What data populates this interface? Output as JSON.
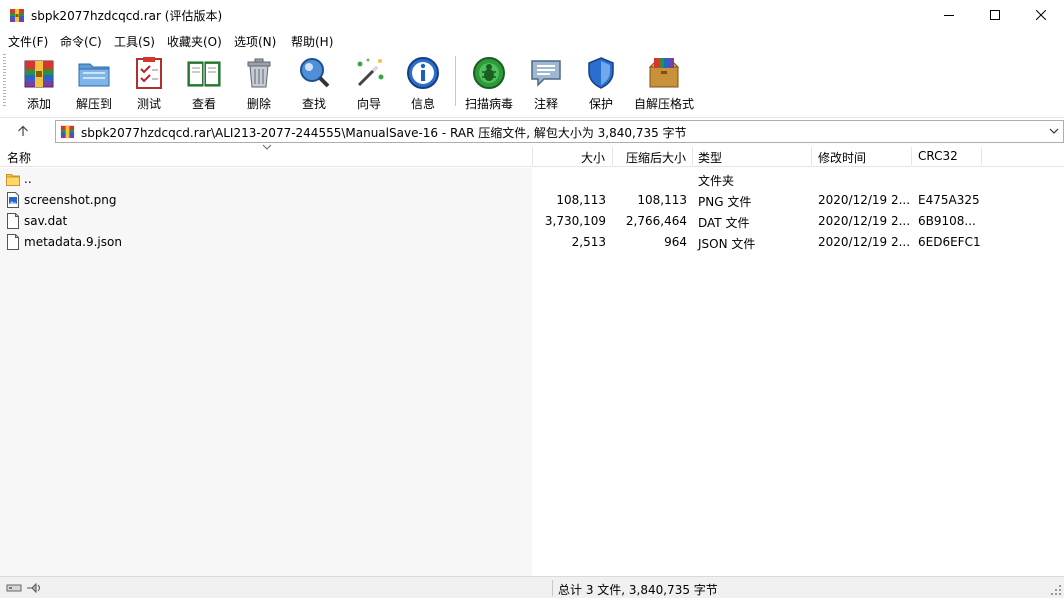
{
  "window": {
    "title": "sbpk2077hzdcqcd.rar (评估版本)",
    "controls": {
      "minimize": "minimize",
      "maximize": "maximize",
      "close": "close"
    }
  },
  "menu": [
    "文件(F)",
    "命令(C)",
    "工具(S)",
    "收藏夹(O)",
    "选项(N)",
    "帮助(H)"
  ],
  "toolbar": {
    "add": "添加",
    "extract_to": "解压到",
    "test": "测试",
    "view": "查看",
    "delete": "删除",
    "find": "查找",
    "wizard": "向导",
    "info": "信息",
    "virus_scan": "扫描病毒",
    "comment": "注释",
    "protect": "保护",
    "sfx": "自解压格式"
  },
  "address": {
    "path": "sbpk2077hzdcqcd.rar\\ALI213-2077-244555\\ManualSave-16 - RAR 压缩文件, 解包大小为 3,840,735 字节"
  },
  "columns": {
    "name": "名称",
    "size": "大小",
    "packed": "压缩后大小",
    "type": "类型",
    "modified": "修改时间",
    "crc": "CRC32"
  },
  "files": [
    {
      "name": "..",
      "size": "",
      "packed": "",
      "type": "文件夹",
      "modified": "",
      "crc": "",
      "icon": "folder-icon"
    },
    {
      "name": "screenshot.png",
      "size": "108,113",
      "packed": "108,113",
      "type": "PNG 文件",
      "modified": "2020/12/19 2...",
      "crc": "E475A325",
      "icon": "image-file-icon"
    },
    {
      "name": "sav.dat",
      "size": "3,730,109",
      "packed": "2,766,464",
      "type": "DAT 文件",
      "modified": "2020/12/19 2...",
      "crc": "6B9108...",
      "icon": "file-icon"
    },
    {
      "name": "metadata.9.json",
      "size": "2,513",
      "packed": "964",
      "type": "JSON 文件",
      "modified": "2020/12/19 2...",
      "crc": "6ED6EFC1",
      "icon": "file-icon"
    }
  ],
  "status": {
    "summary": "总计 3 文件, 3,840,735 字节"
  },
  "colors": {
    "accent_blue": "#1a6fcf",
    "toolbar_separator": "#c8c8c8",
    "name_column_bg": "#f7f7f7",
    "statusbar_bg": "#f0f0f0"
  }
}
